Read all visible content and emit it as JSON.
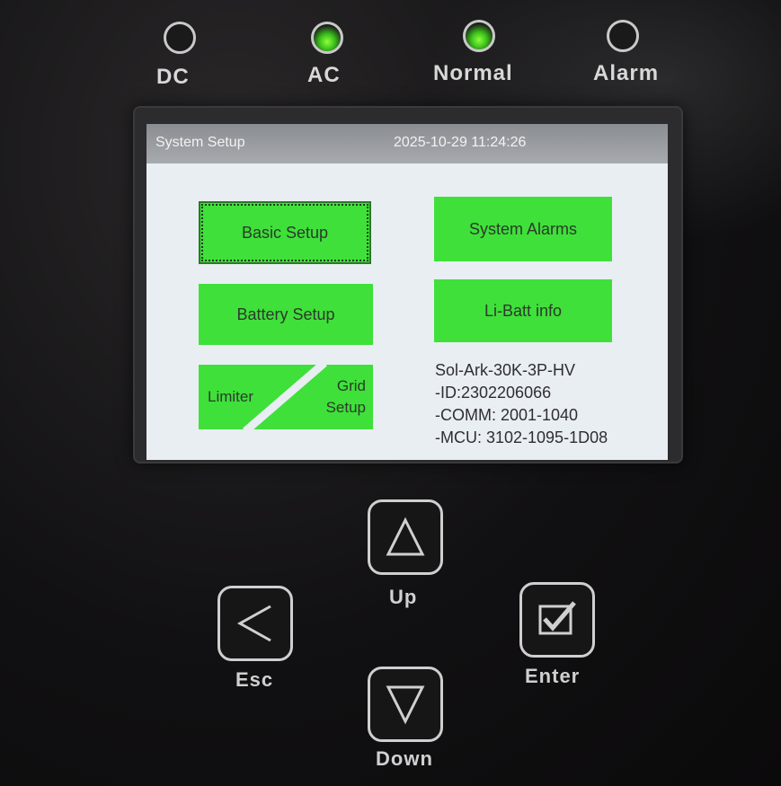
{
  "indicators": [
    {
      "label": "DC",
      "on": false
    },
    {
      "label": "AC",
      "on": true
    },
    {
      "label": "Normal",
      "on": true
    },
    {
      "label": "Alarm",
      "on": false
    }
  ],
  "screen": {
    "title": "System Setup",
    "datetime": "2025-10-29 11:24:26",
    "buttons": {
      "basic_setup": "Basic Setup",
      "system_alarms": "System Alarms",
      "battery_setup": "Battery Setup",
      "li_batt_info": "Li-Batt info",
      "limiter": "Limiter",
      "grid_setup_1": "Grid",
      "grid_setup_2": "Setup"
    },
    "info": {
      "model": "Sol-Ark-30K-3P-HV",
      "id": "-ID:2302206066",
      "comm": "-COMM:  2001-1040",
      "mcu": "-MCU: 3102-1095-1D08"
    },
    "colors": {
      "button_green": "#3fe03a",
      "titlebar": "#9a9da1"
    }
  },
  "keypad": {
    "up": "Up",
    "down": "Down",
    "esc": "Esc",
    "enter": "Enter"
  }
}
